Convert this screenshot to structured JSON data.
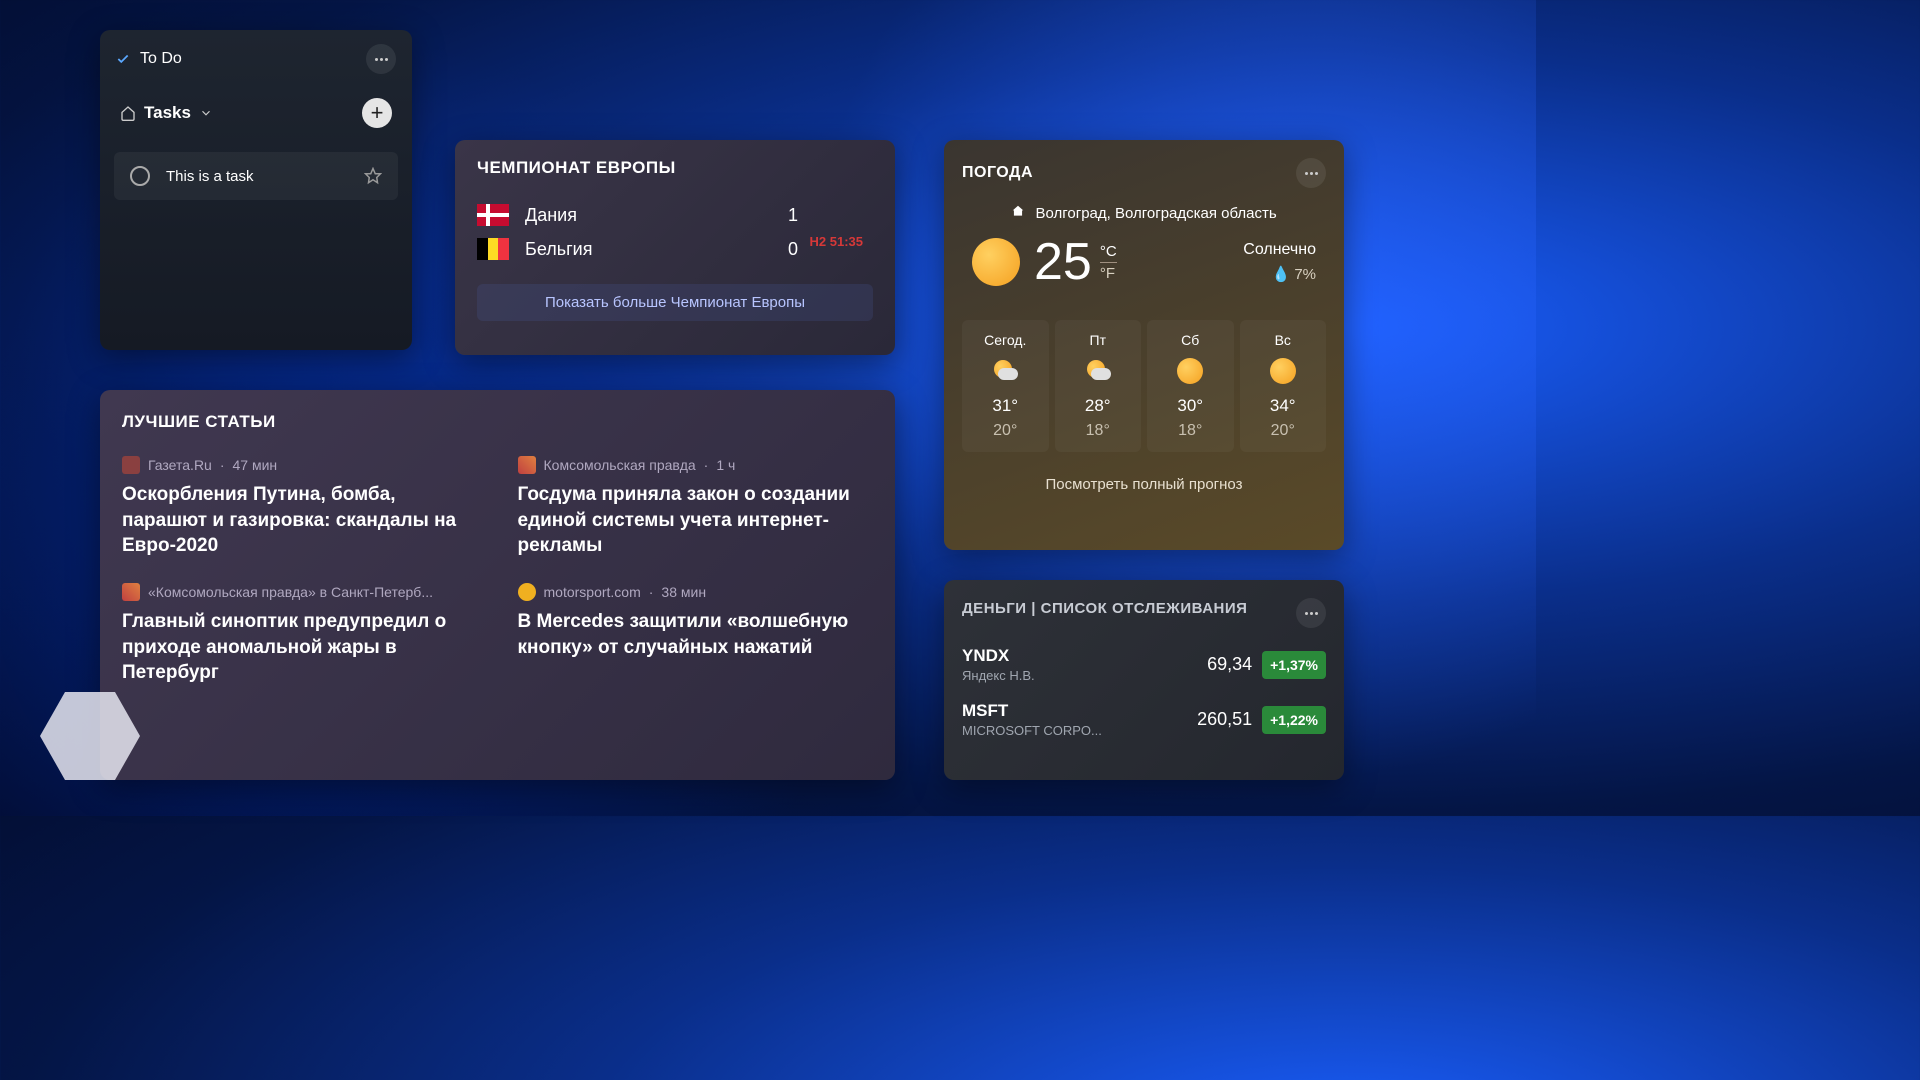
{
  "todo": {
    "title": "To Do",
    "section": "Tasks",
    "task_text": "This is a task"
  },
  "sports": {
    "title": "ЧЕМПИОНАТ ЕВРОПЫ",
    "team1": "Дания",
    "score1": "1",
    "team2": "Бельгия",
    "score2": "0",
    "status": "H2 51:35",
    "more_link": "Показать больше Чемпионат Европы"
  },
  "news": {
    "title": "ЛУЧШИЕ СТАТЬИ",
    "items": [
      {
        "source": "Газета.Ru",
        "time": "47 мин",
        "headline": "Оскорбления Путина, бомба, парашют и газировка: скандалы на Евро-2020"
      },
      {
        "source": "Комсомольская правда",
        "time": "1 ч",
        "headline": "Госдума приняла закон о создании единой системы учета интернет-рекламы"
      },
      {
        "source": "«Комсомольская правда» в Санкт-Петерб...",
        "time": "",
        "headline": "Главный синоптик предупредил о приходе аномальной жары в Петербург"
      },
      {
        "source": "motorsport.com",
        "time": "38 мин",
        "headline": "В Mercedes защитили «волшебную кнопку» от случайных нажатий"
      }
    ]
  },
  "weather": {
    "title": "ПОГОДА",
    "location": "Волгоград, Волгоградская область",
    "temp": "25",
    "unit_c": "°C",
    "unit_f": "°F",
    "condition": "Солнечно",
    "humidity": "7%",
    "forecast": [
      {
        "day": "Сегод.",
        "hi": "31°",
        "lo": "20°",
        "icon": "cloud"
      },
      {
        "day": "Пт",
        "hi": "28°",
        "lo": "18°",
        "icon": "cloud"
      },
      {
        "day": "Сб",
        "hi": "30°",
        "lo": "18°",
        "icon": "sun"
      },
      {
        "day": "Вс",
        "hi": "34°",
        "lo": "20°",
        "icon": "sun"
      }
    ],
    "full_link": "Посмотреть полный прогноз"
  },
  "money": {
    "title": "ДЕНЬГИ | СПИСОК ОТСЛЕЖИВАНИЯ",
    "stocks": [
      {
        "sym": "YNDX",
        "name": "Яндекс Н.В.",
        "price": "69,34",
        "delta": "+1,37%"
      },
      {
        "sym": "MSFT",
        "name": "MICROSOFT CORPO...",
        "price": "260,51",
        "delta": "+1,22%"
      }
    ]
  }
}
